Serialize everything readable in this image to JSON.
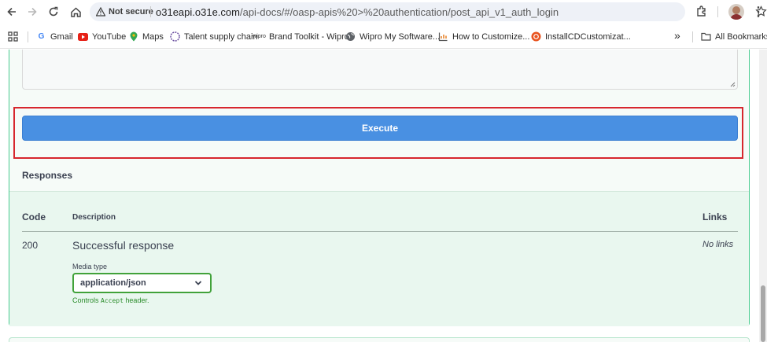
{
  "browser": {
    "security_label": "Not secure",
    "url_host": "o31eapi.o31e.com",
    "url_path": "/api-docs/#/oasp-apis%20>%20authentication/post_api_v1_auth_login",
    "bookmarks": [
      {
        "label": "Gmail",
        "icon": "gmail-icon"
      },
      {
        "label": "YouTube",
        "icon": "youtube-icon"
      },
      {
        "label": "Maps",
        "icon": "maps-icon"
      },
      {
        "label": "Talent supply chain",
        "icon": "wipro-icon"
      },
      {
        "label": "Brand Toolkit - Wipro",
        "icon": "wipro-icon"
      },
      {
        "label": "Wipro My Software...",
        "icon": "globe-icon"
      },
      {
        "label": "How to Customize...",
        "icon": "chart-icon"
      },
      {
        "label": "InstallCDCustomizat...",
        "icon": "ubuntu-icon"
      }
    ],
    "more_bookmarks": "»",
    "all_bookmarks": "All Bookmarks"
  },
  "operation": {
    "execute_label": "Execute",
    "responses_title": "Responses",
    "columns": {
      "code": "Code",
      "description": "Description",
      "links": "Links"
    },
    "response": {
      "code": "200",
      "description": "Successful response",
      "links": "No links",
      "media_type_label": "Media type",
      "media_type_value": "application/json",
      "controls_prefix": "Controls ",
      "controls_code": "Accept",
      "controls_suffix": " header."
    }
  },
  "colors": {
    "execute_bg": "#4990e2",
    "highlight_border": "#d7262e",
    "panel_border": "#49cc90",
    "select_border": "#41a23a"
  }
}
